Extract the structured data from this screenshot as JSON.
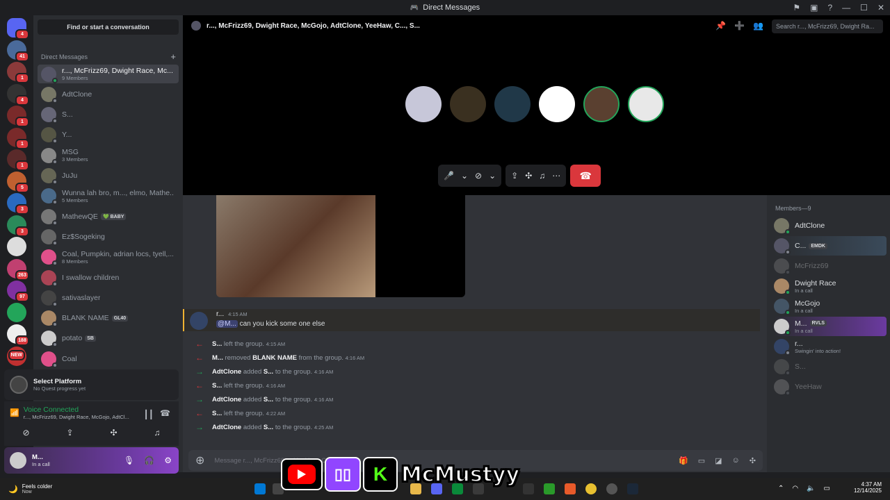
{
  "window": {
    "title": "Direct Messages"
  },
  "guilds": [
    {
      "badge": "4",
      "color": "#5865f2"
    },
    {
      "badge": "41",
      "color": "#4a6a9a"
    },
    {
      "badge": "1",
      "color": "#8b3a3a"
    },
    {
      "badge": "4",
      "color": "#333"
    },
    {
      "badge": "1",
      "color": "#7a2a2a"
    },
    {
      "badge": "1",
      "color": "#7a2a2a"
    },
    {
      "badge": "1",
      "color": "#5a2a2a"
    },
    {
      "badge": "5",
      "color": "#c06030"
    },
    {
      "badge": "3",
      "color": "#2a6ac0"
    },
    {
      "badge": "3",
      "color": "#2a8a5a"
    },
    {
      "badge": "",
      "color": "#ddd"
    },
    {
      "badge": "263",
      "color": "#c04070"
    },
    {
      "badge": "97",
      "color": "#8030a0"
    },
    {
      "badge": "",
      "color": "#23a55a"
    },
    {
      "badge": "188",
      "color": "#eee"
    },
    {
      "badge": "NEW",
      "color": "#c03030"
    }
  ],
  "dm": {
    "find_label": "Find or start a conversation",
    "header": "Direct Messages",
    "plus": "+",
    "items": [
      {
        "name": "r..., McFrizz69, Dwight Race, Mc...",
        "sub": "9 Members",
        "tag": "",
        "color": "#556"
      },
      {
        "name": "AdtClone",
        "sub": "",
        "tag": "",
        "color": "#776"
      },
      {
        "name": "S...",
        "sub": "",
        "tag": "",
        "color": "#667"
      },
      {
        "name": "Y...",
        "sub": "",
        "tag": "",
        "color": "#554"
      },
      {
        "name": "MSG",
        "sub": "3 Members",
        "tag": "",
        "color": "#888"
      },
      {
        "name": "JuJu",
        "sub": "",
        "tag": "",
        "color": "#665"
      },
      {
        "name": "Wunna lah bro, m..., elmo, Mathe...",
        "sub": "5 Members",
        "tag": "",
        "color": "#4a6a8a"
      },
      {
        "name": "MathewQE",
        "sub": "",
        "tag": "💚 BABY",
        "color": "#777"
      },
      {
        "name": "Ez$Sogeking",
        "sub": "",
        "tag": "",
        "color": "#666"
      },
      {
        "name": "Coal, Pumpkin, adrian locs, tyell,...",
        "sub": "8 Members",
        "tag": "",
        "color": "#e0508a"
      },
      {
        "name": "I swallow children",
        "sub": "",
        "tag": "",
        "color": "#a45"
      },
      {
        "name": "sativaslayer",
        "sub": "",
        "tag": "",
        "color": "#444"
      },
      {
        "name": "BLANK NAME",
        "sub": "",
        "tag": "GL40",
        "color": "#a86"
      },
      {
        "name": "potato",
        "sub": "",
        "tag": "SB",
        "color": "#ccc"
      },
      {
        "name": "Coal",
        "sub": "",
        "tag": "",
        "color": "#e0508a"
      }
    ]
  },
  "quest": {
    "title": "Select Platform",
    "sub": "No Quest progress yet"
  },
  "voice": {
    "status": "Voice Connected",
    "channel": "r..., McFrizz69, Dwight Race, McGojo, AdtCl..."
  },
  "user": {
    "name": "M...",
    "status": "In a call"
  },
  "call": {
    "title": "r..., McFrizz69, Dwight Race, McGojo, AdtClone, YeeHaw, C..., S...",
    "search_placeholder": "Search r..., McFrizz69, Dwight Ra...",
    "participants": [
      {
        "color": "#c7c7d9"
      },
      {
        "color": "#3a3020"
      },
      {
        "color": "#203848"
      },
      {
        "color": "#ffffff"
      },
      {
        "color": "#5a4030"
      },
      {
        "color": "#e8e8e8"
      }
    ]
  },
  "chat": {
    "message": {
      "author": "r...",
      "time": "4:15 AM",
      "mention": "@M...",
      "text": "can you kick some one else"
    },
    "events": [
      {
        "dir": "left",
        "actor": "S...",
        "action": "left the group.",
        "target": "",
        "suffix": "",
        "time": "4:15 AM"
      },
      {
        "dir": "left",
        "actor": "M...",
        "action": "removed",
        "target": "BLANK NAME",
        "suffix": "from the group.",
        "time": "4:16 AM"
      },
      {
        "dir": "right",
        "actor": "AdtClone",
        "action": "added",
        "target": "S...",
        "suffix": "to the group.",
        "time": "4:16 AM"
      },
      {
        "dir": "left",
        "actor": "S...",
        "action": "left the group.",
        "target": "",
        "suffix": "",
        "time": "4:16 AM"
      },
      {
        "dir": "right",
        "actor": "AdtClone",
        "action": "added",
        "target": "S...",
        "suffix": "to the group.",
        "time": "4:16 AM"
      },
      {
        "dir": "left",
        "actor": "S...",
        "action": "left the group.",
        "target": "",
        "suffix": "",
        "time": "4:22 AM"
      },
      {
        "dir": "right",
        "actor": "AdtClone",
        "action": "added",
        "target": "S...",
        "suffix": "to the group.",
        "time": "4:25 AM"
      }
    ],
    "composer_placeholder": "Message r..., McFrizz69, ...YeeHaw, C..., S..."
  },
  "members": {
    "header": "Members—9",
    "list": [
      {
        "name": "AdtClone",
        "sub": "",
        "tag": "",
        "dim": false,
        "color": "#776",
        "online": true
      },
      {
        "name": "C...",
        "sub": "",
        "tag": "EMDK",
        "dim": false,
        "color": "#556",
        "online": false
      },
      {
        "name": "McFrizz69",
        "sub": "",
        "tag": "",
        "dim": true,
        "color": "#888",
        "online": false
      },
      {
        "name": "Dwight Race",
        "sub": "In a call",
        "tag": "",
        "dim": false,
        "color": "#a86",
        "online": true
      },
      {
        "name": "McGojo",
        "sub": "In a call",
        "tag": "",
        "dim": false,
        "color": "#456",
        "online": true
      },
      {
        "name": "M...",
        "sub": "In a call",
        "tag": "RVLS",
        "dim": false,
        "color": "#ccc",
        "online": true
      },
      {
        "name": "r...",
        "sub": "Swingin' into action!",
        "tag": "",
        "dim": false,
        "color": "#346",
        "online": false
      },
      {
        "name": "S...",
        "sub": "",
        "tag": "",
        "dim": true,
        "color": "#777",
        "online": false
      },
      {
        "name": "YeeHaw",
        "sub": "",
        "tag": "",
        "dim": true,
        "color": "#999",
        "online": false
      }
    ]
  },
  "taskbar": {
    "weather_title": "Feels colder",
    "weather_sub": "Now",
    "time": "4:37 AM",
    "date": "12/14/2025"
  },
  "overlay": {
    "handle": "McMustyy"
  }
}
